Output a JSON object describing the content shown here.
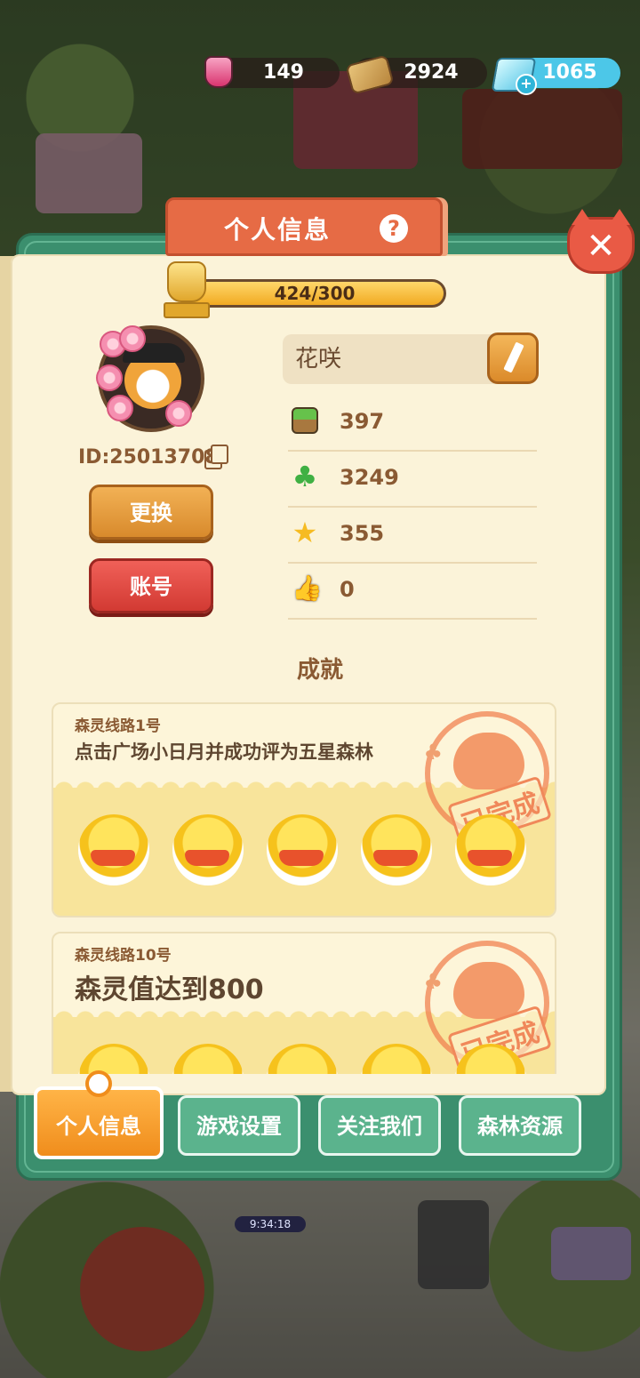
{
  "resources": {
    "potion": "149",
    "wood": "2924",
    "gems": "1065"
  },
  "panel": {
    "title": "个人信息",
    "help_symbol": "?",
    "close_symbol": "✕"
  },
  "profile": {
    "xp_text": "424/300",
    "xp_fraction": 1.0,
    "user_id": "ID:25013708",
    "name": "花咲",
    "change_button": "更换",
    "account_button": "账号"
  },
  "stats": [
    {
      "icon": "grass-block-icon",
      "value": "397"
    },
    {
      "icon": "clover-icon",
      "value": "3249"
    },
    {
      "icon": "star-icon",
      "value": "355"
    },
    {
      "icon": "thumbs-up-icon",
      "value": "0"
    }
  ],
  "achievements": {
    "title": "成就",
    "cards": [
      {
        "route": "森灵线路1号",
        "description": "点击广场小日月并成功评为五星森林",
        "stamp": "已完成",
        "reward_count": 5
      },
      {
        "route": "森灵线路10号",
        "description": "森灵值达到800",
        "stamp": "已完成",
        "reward_count": 5
      }
    ]
  },
  "tabs": {
    "profile": "个人信息",
    "settings": "游戏设置",
    "follow": "关注我们",
    "resources": "森林资源"
  },
  "background": {
    "timer": "9:34:18"
  }
}
